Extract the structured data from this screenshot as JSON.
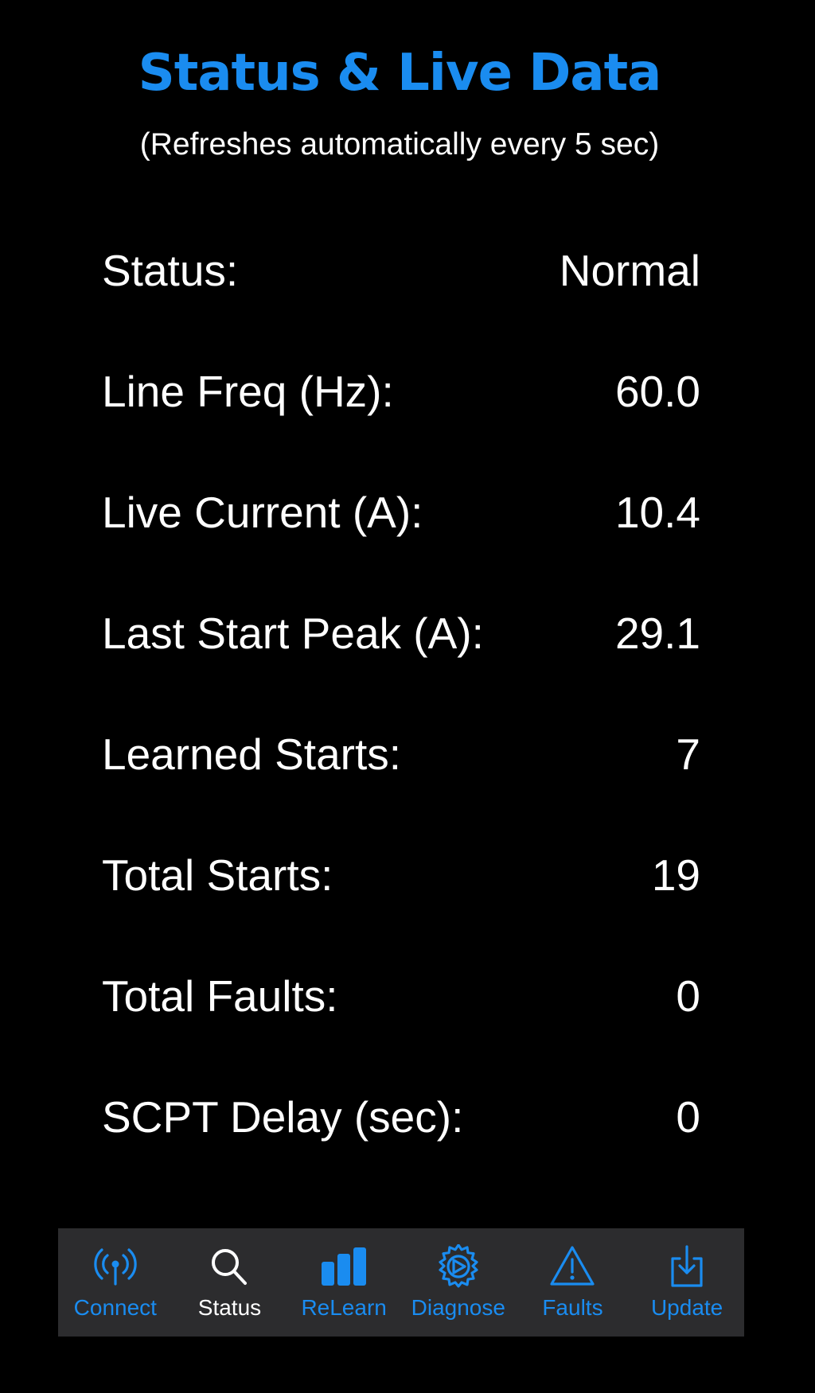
{
  "header": {
    "title": "Status & Live Data",
    "subtitle": "(Refreshes automatically every 5 sec)"
  },
  "rows": [
    {
      "label": "Status:",
      "value": "Normal"
    },
    {
      "label": "Line Freq (Hz):",
      "value": "60.0"
    },
    {
      "label": "Live Current (A):",
      "value": "10.4"
    },
    {
      "label": "Last Start Peak (A):",
      "value": "29.1"
    },
    {
      "label": "Learned Starts:",
      "value": "7"
    },
    {
      "label": "Total Starts:",
      "value": "19"
    },
    {
      "label": "Total Faults:",
      "value": "0"
    },
    {
      "label": "SCPT Delay (sec):",
      "value": "0"
    }
  ],
  "tabs": [
    {
      "label": "Connect",
      "icon": "antenna-icon",
      "active": false
    },
    {
      "label": "Status",
      "icon": "search-icon",
      "active": true
    },
    {
      "label": "ReLearn",
      "icon": "bars-icon",
      "active": false
    },
    {
      "label": "Diagnose",
      "icon": "gear-icon",
      "active": false
    },
    {
      "label": "Faults",
      "icon": "warning-icon",
      "active": false
    },
    {
      "label": "Update",
      "icon": "download-icon",
      "active": false
    }
  ],
  "colors": {
    "accent": "#1a8cf0",
    "background": "#000000",
    "tab_bar": "#2c2c2e",
    "text": "#ffffff"
  }
}
